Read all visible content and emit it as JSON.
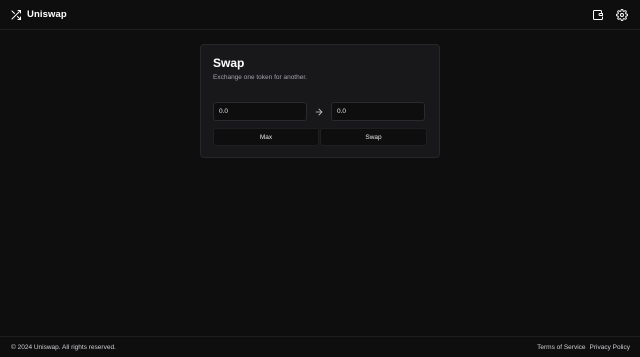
{
  "header": {
    "brand_icon": "shuffle-icon",
    "brand_name": "Uniswap",
    "actions": [
      {
        "icon": "wallet-icon"
      },
      {
        "icon": "gear-icon"
      }
    ]
  },
  "swap_card": {
    "title": "Swap",
    "subtitle": "Exchange one token for another.",
    "from_input": {
      "value": "0.0"
    },
    "arrow_icon": "arrow-right-icon",
    "to_input": {
      "value": "0.0"
    },
    "max_label": "Max",
    "swap_label": "Swap"
  },
  "footer": {
    "copyright": "© 2024 Uniswap. All rights reserved.",
    "links": [
      "Terms of Service",
      "Privacy Policy"
    ]
  },
  "colors": {
    "background": "#0e0e0f",
    "card": "#18181b",
    "border": "#26262a",
    "text": "#ffffff",
    "muted": "#a3a3a8"
  }
}
